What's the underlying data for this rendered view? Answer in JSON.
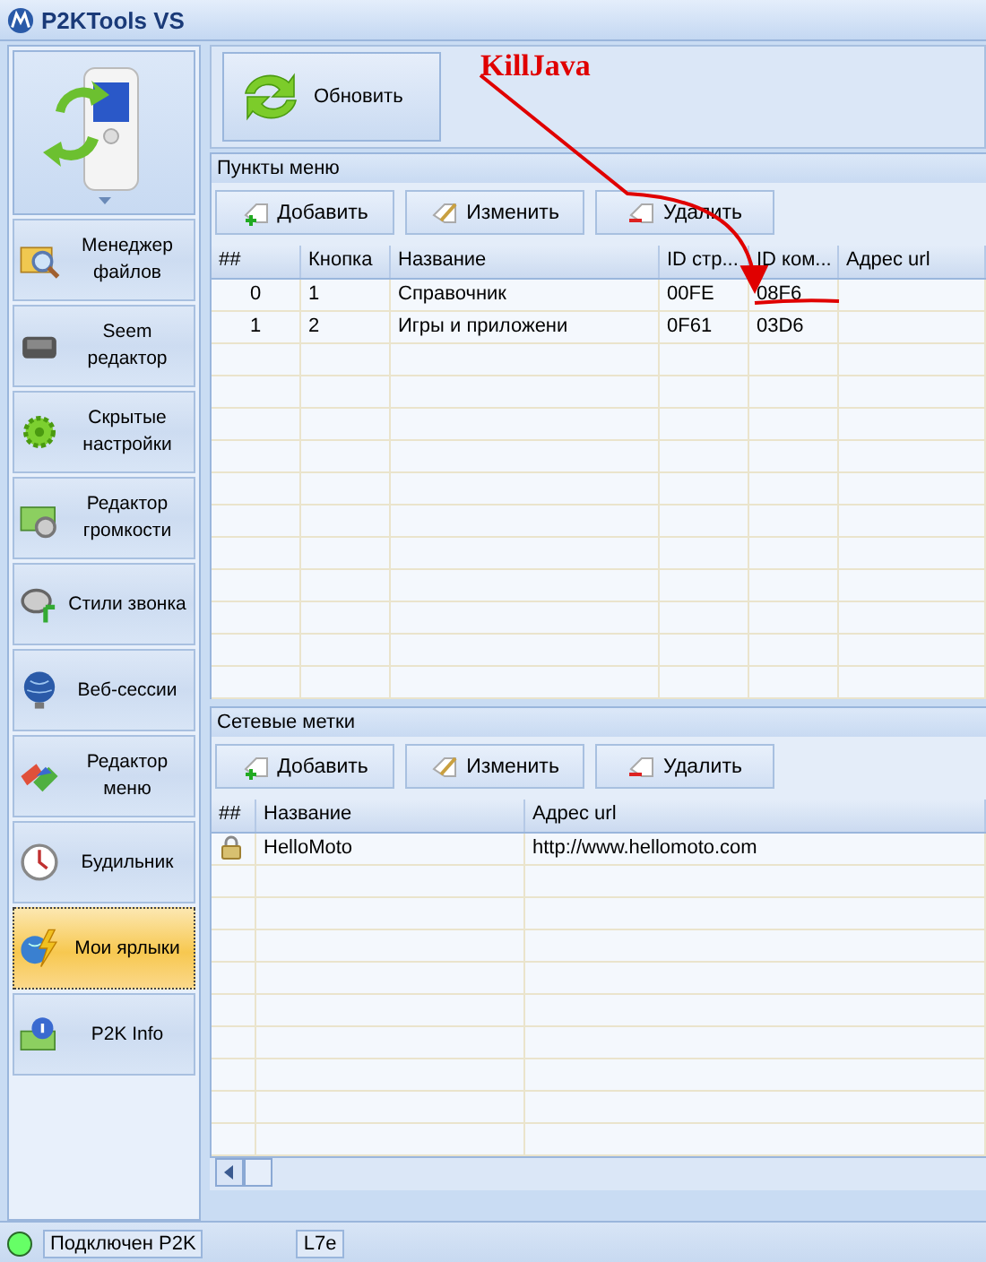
{
  "window": {
    "title": "P2KTools VS"
  },
  "sidebar": {
    "items": [
      {
        "label": "Менеджер файлов",
        "selected": false
      },
      {
        "label": "Seem редактор",
        "selected": false
      },
      {
        "label": "Скрытые настройки",
        "selected": false
      },
      {
        "label": "Редактор громкости",
        "selected": false
      },
      {
        "label": "Стили звонка",
        "selected": false
      },
      {
        "label": "Веб-сессии",
        "selected": false
      },
      {
        "label": "Редактор меню",
        "selected": false
      },
      {
        "label": "Будильник",
        "selected": false
      },
      {
        "label": "Мои ярлыки",
        "selected": true
      },
      {
        "label": "P2K Info",
        "selected": false
      }
    ]
  },
  "toolbar": {
    "refresh": "Обновить"
  },
  "sections": [
    {
      "title": "Пункты меню",
      "buttons": [
        "Добавить",
        "Изменить",
        "Удалить"
      ],
      "table": {
        "kind": "numbered",
        "columns": [
          "##",
          "Кнопка",
          "Название",
          "ID стр...",
          "ID ком...",
          "Адрес url"
        ],
        "rows": [
          [
            "0",
            "1",
            "Справочник",
            "00FE",
            "08F6"
          ],
          [
            "1",
            "2",
            "Игры и приложени",
            "0F61",
            "03D6"
          ]
        ]
      }
    },
    {
      "title": "Сетевые метки",
      "buttons": [
        "Добавить",
        "Изменить",
        "Удалить"
      ],
      "table": {
        "kind": "icon",
        "columns": [
          "##",
          "Название",
          "Адрес url"
        ],
        "rows": [
          [
            "",
            "HelloMoto",
            "http://www.hellomoto.com"
          ]
        ]
      }
    }
  ],
  "status_bar": {
    "connected": true,
    "connection": "Подключен P2K",
    "model": "L7e"
  },
  "annotation": {
    "text": "KillJava"
  }
}
